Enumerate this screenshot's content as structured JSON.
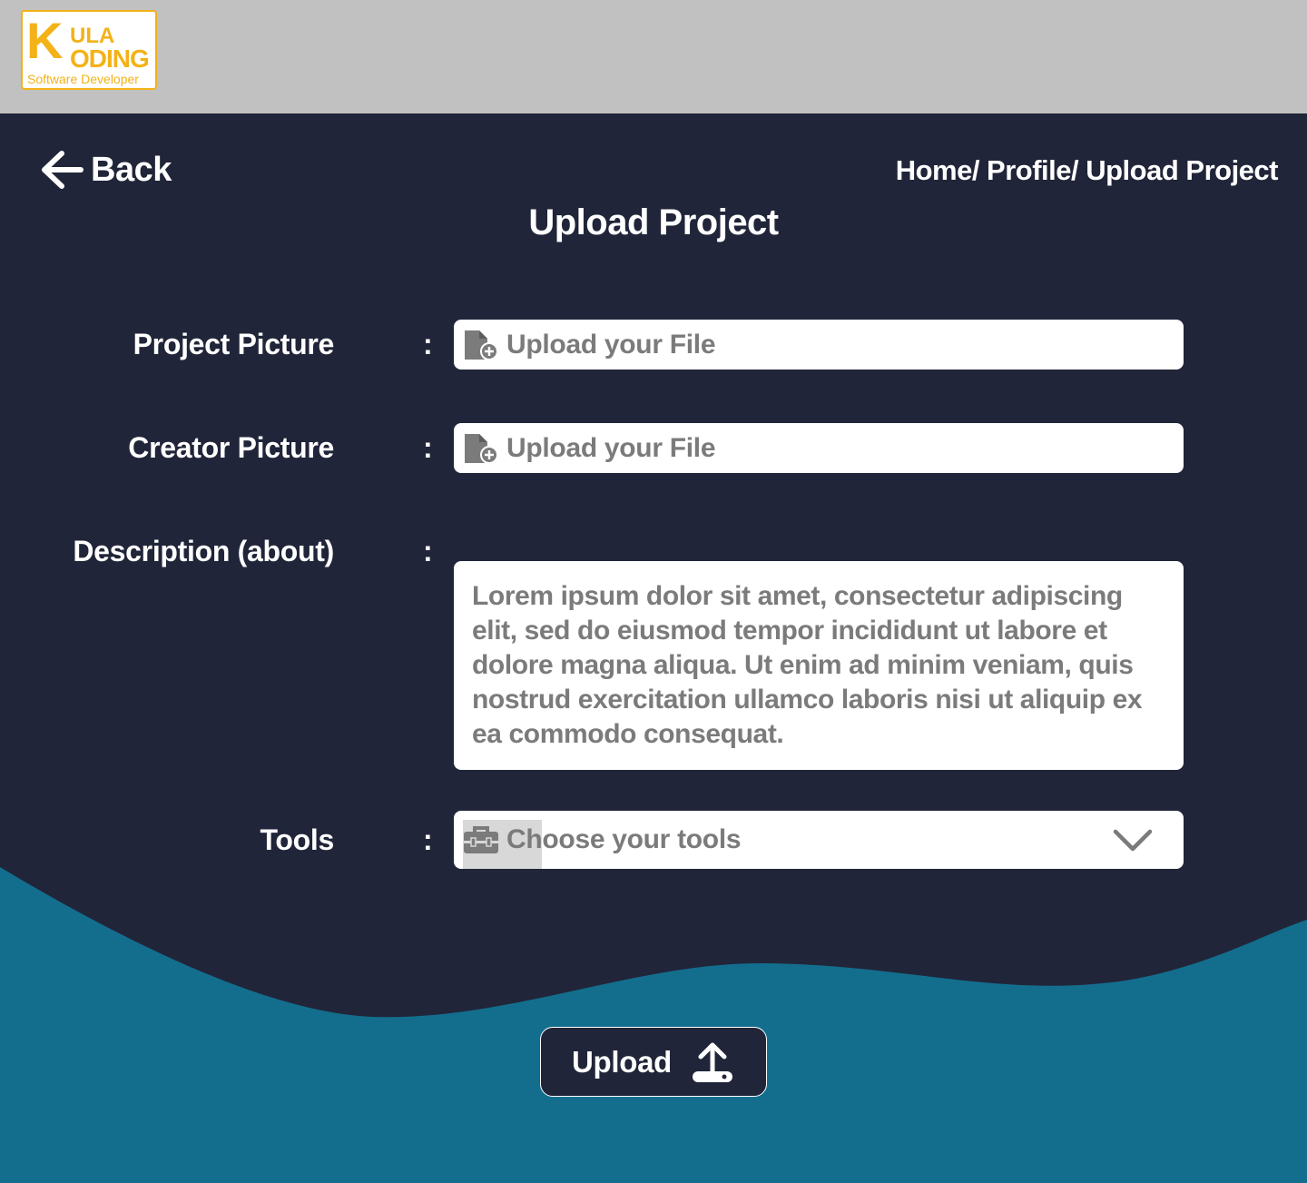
{
  "logo": {
    "letter": "K",
    "line1": "ULA",
    "line2": "ODING",
    "tagline": "Software Developer"
  },
  "nav": {
    "back_label": "Back",
    "breadcrumb": "Home/ Profile/ Upload Project"
  },
  "page": {
    "title": "Upload Project"
  },
  "form": {
    "project_picture": {
      "label": "Project Picture",
      "colon": ":",
      "placeholder": "Upload your File"
    },
    "creator_picture": {
      "label": "Creator Picture",
      "colon": ":",
      "placeholder": "Upload your File"
    },
    "description": {
      "label": "Description (about)",
      "colon": ":",
      "value": "Lorem ipsum dolor sit amet, consectetur adipiscing elit, sed do eiusmod tempor incididunt ut labore et dolore magna aliqua. Ut enim ad minim veniam, quis nostrud exercitation ullamco laboris nisi ut aliquip ex ea commodo consequat."
    },
    "tools": {
      "label": "Tools",
      "colon": ":",
      "placeholder": "Choose your tools"
    }
  },
  "actions": {
    "upload_label": "Upload"
  },
  "colors": {
    "header_bg": "#c1c1c1",
    "page_bg": "#212539",
    "wave": "#136e8d",
    "logo_accent": "#f3b218",
    "placeholder_text": "#7b7b7b"
  },
  "icons": {
    "back": "arrow-left-icon",
    "file": "file-add-icon",
    "tools": "toolbox-icon",
    "dropdown": "chevron-down-icon",
    "upload": "upload-icon"
  }
}
